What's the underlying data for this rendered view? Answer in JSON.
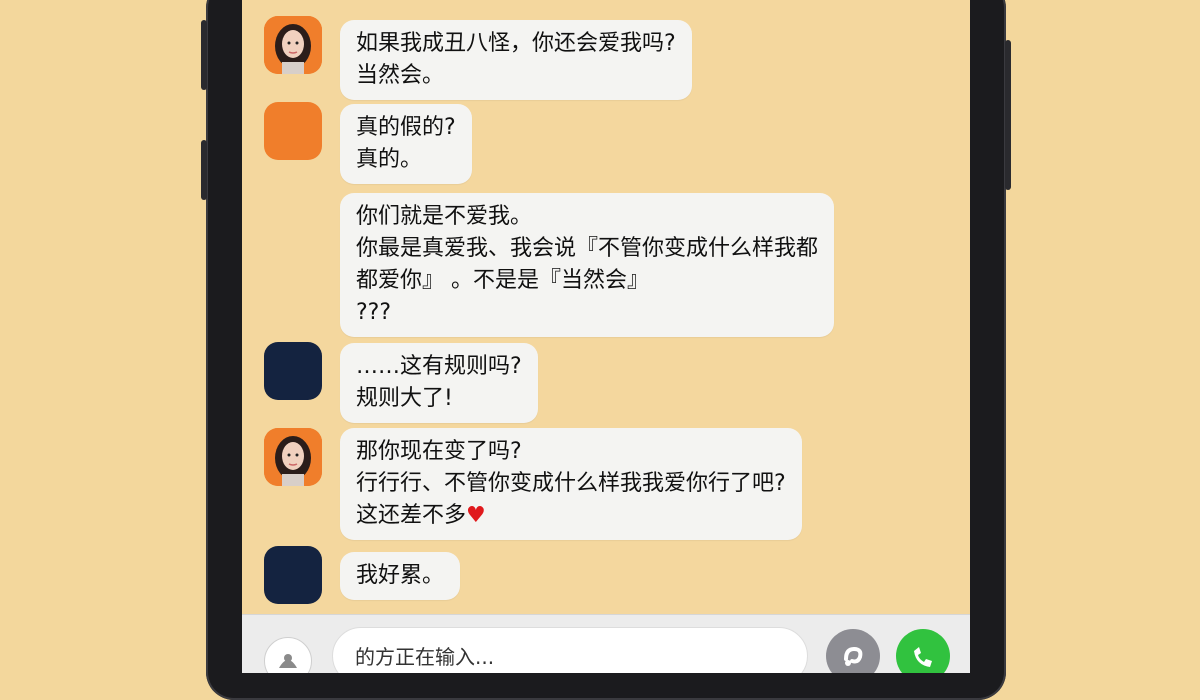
{
  "messages": [
    {
      "avatar": "female-portrait",
      "lines": [
        "如果我成丑八怪，你还会爱我吗?",
        "当然会。"
      ]
    },
    {
      "avatar": "orange",
      "lines": [
        "真的假的?",
        "真的。"
      ]
    },
    {
      "avatar": "none",
      "lines": [
        "你们就是不爱我。",
        "你最是真爱我、我会说『不管你变成什么样我都",
        "都爱你』  。不是是『当然会』",
        "???"
      ]
    },
    {
      "avatar": "navy",
      "lines": [
        "……这有规则吗?",
        "规则大了!"
      ]
    },
    {
      "avatar": "female-portrait",
      "lines": [
        "那你现在变了吗?",
        "行行行、不管你变成什么样我我爱你行了吧?",
        "这还差不多"
      ],
      "heart": "♥"
    },
    {
      "avatar": "navy",
      "lines": [
        "我好累。"
      ]
    }
  ],
  "input": {
    "placeholder": "的方正在输入..."
  },
  "icons": {
    "plus": "add-icon",
    "voice": "voice-icon",
    "call": "phone-icon"
  },
  "colors": {
    "background": "#f4d79e",
    "accent_orange": "#f07e2b",
    "accent_navy": "#142340",
    "call_green": "#31c23f"
  }
}
